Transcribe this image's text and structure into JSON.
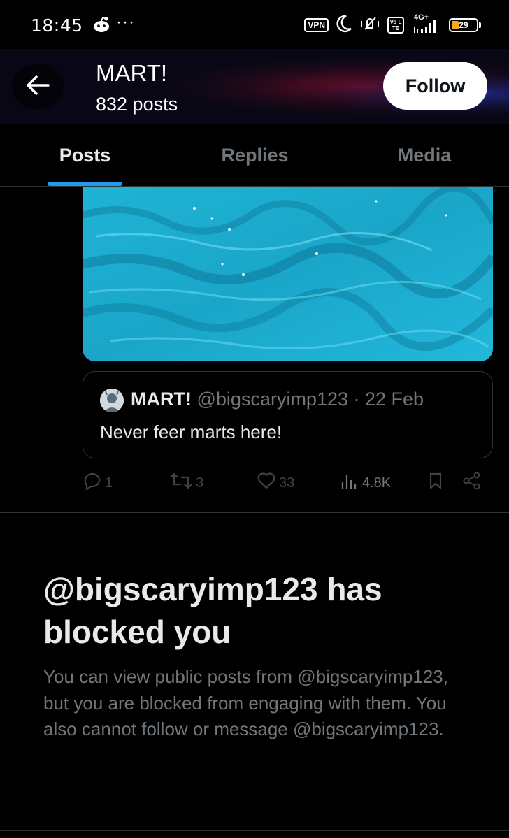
{
  "status_bar": {
    "time": "18:45",
    "more_glyph": "···",
    "vpn": "VPN",
    "network": "4G+",
    "volte": "Vo LTE",
    "battery": "29",
    "icons": [
      "reddit-icon",
      "more-dots-icon",
      "vpn-icon",
      "moon-icon",
      "mute-vibrate-icon",
      "volte-icon",
      "signal-icon",
      "battery-icon"
    ]
  },
  "header": {
    "name": "MART!",
    "posts_count": "832 posts",
    "follow_label": "Follow"
  },
  "tabs": [
    {
      "label": "Posts",
      "active": true
    },
    {
      "label": "Replies",
      "active": false
    },
    {
      "label": "Media",
      "active": false
    }
  ],
  "post": {
    "quote": {
      "name": "MART!",
      "handle": "@bigscaryimp123 · 22 Feb",
      "text": "Never feer marts here!"
    },
    "actions": {
      "replies": "1",
      "reposts": "3",
      "likes": "33",
      "views": "4.8K"
    }
  },
  "blocked": {
    "title": "@bigscaryimp123 has blocked you",
    "description": "You can view public posts from @bigscaryimp123, but you are blocked from engaging with them. You also cannot follow or message @bigscaryimp123."
  },
  "colors": {
    "accent": "#1d9bf0",
    "background": "#000000",
    "muted_text": "#71767b",
    "border": "#2f3336"
  }
}
